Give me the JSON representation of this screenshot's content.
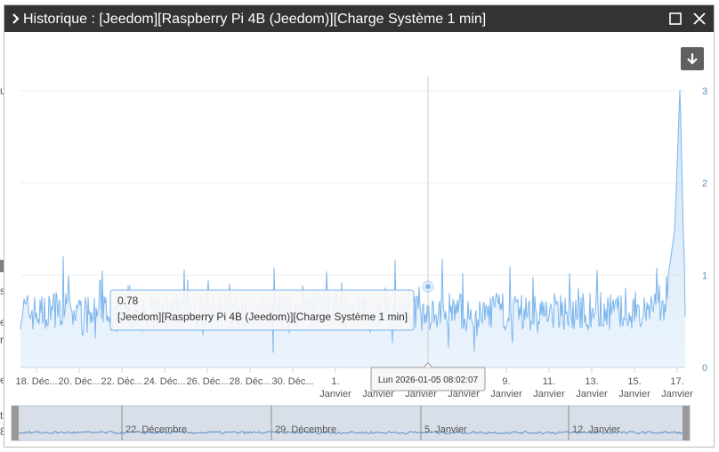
{
  "window": {
    "title": "Historique : [Jeedom][Raspberry Pi 4B (Jeedom)][Charge Système 1 min]"
  },
  "background_fragments": [
    "uj",
    "s",
    "e",
    "r",
    "e",
    "t",
    "8"
  ],
  "toolbar": {
    "download_icon": "arrow-down-icon",
    "maximize_icon": "square-icon",
    "close_icon": "x-icon"
  },
  "chart_data": {
    "type": "area",
    "title": "",
    "xlabel": "",
    "ylabel": "",
    "y_axis_position": "right",
    "ylim": [
      0,
      3.2
    ],
    "y_ticks": [
      "0",
      "1",
      "2",
      "3"
    ],
    "x_tick_labels": [
      [
        "18. Déc..."
      ],
      [
        "20. Déc..."
      ],
      [
        "22. Déc..."
      ],
      [
        "24. Déc..."
      ],
      [
        "26. Déc..."
      ],
      [
        "28. Déc..."
      ],
      [
        "30. Déc..."
      ],
      [
        "1.",
        "Janvier"
      ],
      [
        "3.",
        "Janvier"
      ],
      [
        "5.",
        "Janvier"
      ],
      [
        "7.",
        "Janvier"
      ],
      [
        "9.",
        "Janvier"
      ],
      [
        "11.",
        "Janvier"
      ],
      [
        "13.",
        "Janvier"
      ],
      [
        "15.",
        "Janvier"
      ],
      [
        "17.",
        "Janvier"
      ]
    ],
    "x_range": [
      "2025-12-17",
      "2026-01-18"
    ],
    "series": [
      {
        "name": "[Jeedom][Raspberry Pi 4B (Jeedom)][Charge Système 1 min]",
        "color": "#7cb5ec",
        "typical_range": [
          0.3,
          1.0
        ],
        "points": [
          [
            "2025-12-17",
            0.62
          ],
          [
            "2025-12-18",
            0.58
          ],
          [
            "2025-12-19",
            0.66
          ],
          [
            "2025-12-20",
            0.55
          ],
          [
            "2025-12-21",
            0.6
          ],
          [
            "2025-12-22",
            0.63
          ],
          [
            "2025-12-23",
            0.57
          ],
          [
            "2025-12-24",
            0.61
          ],
          [
            "2025-12-25",
            0.59
          ],
          [
            "2025-12-26",
            0.64
          ],
          [
            "2025-12-27",
            0.6
          ],
          [
            "2025-12-28",
            0.58
          ],
          [
            "2025-12-29",
            0.62
          ],
          [
            "2025-12-30",
            0.61
          ],
          [
            "2025-12-31",
            0.63
          ],
          [
            "2026-01-01",
            0.65
          ],
          [
            "2026-01-02",
            0.6
          ],
          [
            "2026-01-03",
            0.58
          ],
          [
            "2026-01-04",
            0.62
          ],
          [
            "2026-01-05",
            0.59
          ],
          [
            "2026-01-06",
            0.61
          ],
          [
            "2026-01-07",
            0.6
          ],
          [
            "2026-01-08",
            0.57
          ],
          [
            "2026-01-09",
            0.62
          ],
          [
            "2026-01-10",
            0.59
          ],
          [
            "2026-01-11",
            0.58
          ],
          [
            "2026-01-12",
            0.61
          ],
          [
            "2026-01-13",
            0.6
          ],
          [
            "2026-01-14",
            0.62
          ],
          [
            "2026-01-15",
            0.59
          ],
          [
            "2026-01-16",
            0.64
          ],
          [
            "2026-01-17",
            0.7
          ],
          [
            "2026-01-17T12:00",
            1.5
          ],
          [
            "2026-01-17T18:00",
            3.05
          ],
          [
            "2026-01-18",
            0.55
          ]
        ]
      }
    ],
    "tooltip": {
      "value": "0.78",
      "series": "[Jeedom][Raspberry Pi 4B (Jeedom)][Charge Système 1 min]",
      "date": "Lun 2026-01-05 08:02:07"
    },
    "navigator_labels": [
      "22. Décembre",
      "29. Décembre",
      "5. Janvier",
      "12. Janvier"
    ]
  }
}
